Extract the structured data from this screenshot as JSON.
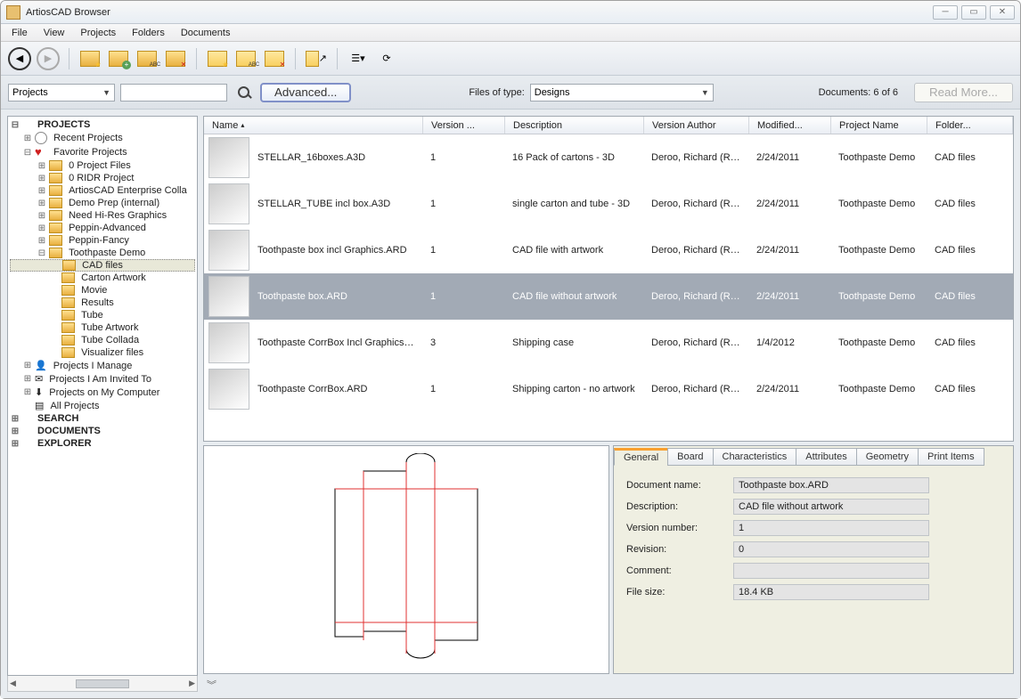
{
  "window": {
    "title": "ArtiosCAD Browser"
  },
  "menu": [
    "File",
    "View",
    "Projects",
    "Folders",
    "Documents"
  ],
  "search": {
    "scope": "Projects",
    "advanced": "Advanced...",
    "filesOfTypeLabel": "Files of type:",
    "filesOfType": "Designs",
    "docCount": "Documents: 6 of 6",
    "readMore": "Read More..."
  },
  "tree": {
    "root": "PROJECTS",
    "recent": "Recent Projects",
    "favorite": "Favorite Projects",
    "favChildren": [
      "0 Project Files",
      "0 RIDR Project",
      "ArtiosCAD Enterprise Colla",
      "Demo Prep (internal)",
      "Need Hi-Res Graphics",
      "Peppin-Advanced",
      "Peppin-Fancy",
      "Toothpaste Demo"
    ],
    "toothpasteChildren": [
      "CAD files",
      "Carton Artwork",
      "Movie",
      "Results",
      "Tube",
      "Tube Artwork",
      "Tube Collada",
      "Visualizer files"
    ],
    "manage": "Projects I Manage",
    "invited": "Projects I Am Invited To",
    "computer": "Projects on My Computer",
    "all": "All Projects",
    "search": "SEARCH",
    "documents": "DOCUMENTS",
    "explorer": "EXPLORER"
  },
  "cols": [
    "Name",
    "Version ...",
    "Description",
    "Version Author",
    "Modified...",
    "Project Name",
    "Folder..."
  ],
  "rows": [
    {
      "name": "STELLAR_16boxes.A3D",
      "ver": "1",
      "desc": "16 Pack of cartons - 3D",
      "author": "Deroo, Richard (RIDR)",
      "mod": "2/24/2011",
      "proj": "Toothpaste Demo",
      "folder": "CAD files"
    },
    {
      "name": "STELLAR_TUBE incl box.A3D",
      "ver": "1",
      "desc": "single carton and tube - 3D",
      "author": "Deroo, Richard (RIDR)",
      "mod": "2/24/2011",
      "proj": "Toothpaste Demo",
      "folder": "CAD files"
    },
    {
      "name": "Toothpaste box incl Graphics.ARD",
      "ver": "1",
      "desc": "CAD file with artwork",
      "author": "Deroo, Richard (RIDR)",
      "mod": "2/24/2011",
      "proj": "Toothpaste Demo",
      "folder": "CAD files"
    },
    {
      "name": "Toothpaste box.ARD",
      "ver": "1",
      "desc": "CAD file without artwork",
      "author": "Deroo, Richard (RIDR)",
      "mod": "2/24/2011",
      "proj": "Toothpaste Demo",
      "folder": "CAD files"
    },
    {
      "name": "Toothpaste CorrBox Incl Graphics.ARD",
      "ver": "3",
      "desc": "Shipping case",
      "author": "Deroo, Richard (RIDR)",
      "mod": "1/4/2012",
      "proj": "Toothpaste Demo",
      "folder": "CAD files"
    },
    {
      "name": "Toothpaste CorrBox.ARD",
      "ver": "1",
      "desc": "Shipping carton - no artwork",
      "author": "Deroo, Richard (RIDR)",
      "mod": "2/24/2011",
      "proj": "Toothpaste Demo",
      "folder": "CAD files"
    }
  ],
  "tabs": [
    "General",
    "Board",
    "Characteristics",
    "Attributes",
    "Geometry",
    "Print Items"
  ],
  "props": {
    "labels": {
      "docname": "Document name:",
      "desc": "Description:",
      "ver": "Version number:",
      "rev": "Revision:",
      "cmt": "Comment:",
      "size": "File size:"
    },
    "values": {
      "docname": "Toothpaste box.ARD",
      "desc": "CAD file without artwork",
      "ver": "1",
      "rev": "0",
      "cmt": "",
      "size": "18.4 KB"
    }
  }
}
